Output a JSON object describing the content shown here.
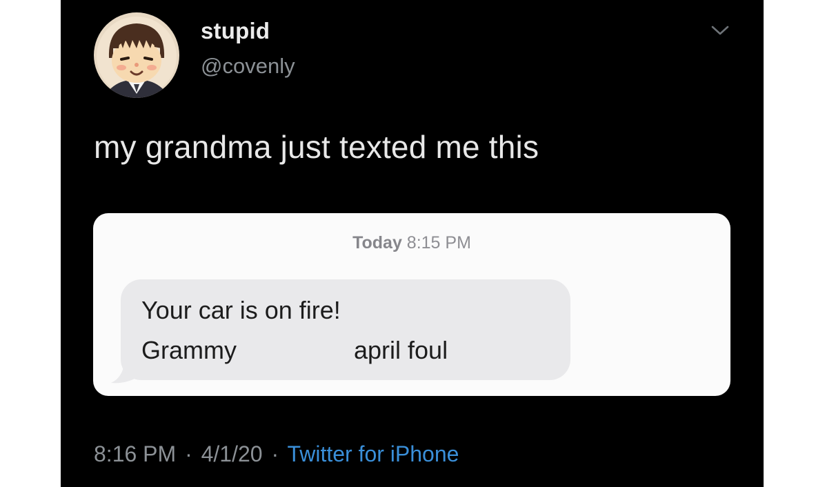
{
  "tweet": {
    "display_name": "stupid",
    "handle": "@covenly",
    "text": "my grandma just texted me this",
    "menu_icon": "chevron-down-icon",
    "avatar_icon": "avatar-cartoon-girl",
    "media": {
      "timestamp_label": "Today",
      "timestamp_time": "8:15 PM",
      "message_line1": "Your car is on fire!",
      "message_line2": "Grammy",
      "message_signoff": "april foul"
    },
    "footer": {
      "time": "8:16 PM",
      "separator": "·",
      "date": "4/1/20",
      "source": "Twitter for iPhone"
    }
  },
  "colors": {
    "background": "#000000",
    "link": "#3a8fd9",
    "muted": "#8c9196",
    "bubble": "#e9e9eb"
  }
}
